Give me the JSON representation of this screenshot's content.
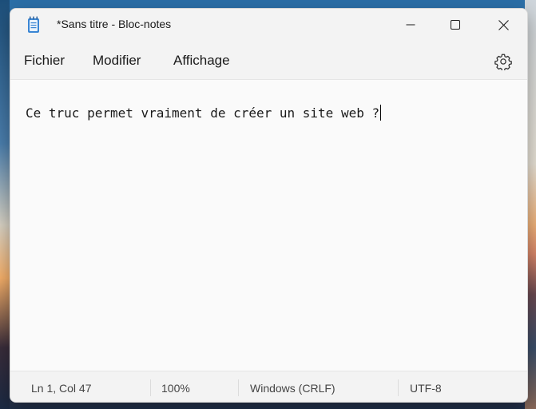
{
  "window": {
    "title": "*Sans titre - Bloc-notes",
    "app_icon": "notepad-icon"
  },
  "titlebar_buttons": {
    "minimize_icon": "minimize-icon",
    "maximize_icon": "maximize-icon",
    "close_icon": "close-icon"
  },
  "menu": {
    "items": [
      {
        "label": "Fichier"
      },
      {
        "label": "Modifier"
      },
      {
        "label": "Affichage"
      }
    ],
    "settings_icon": "gear-icon"
  },
  "editor": {
    "content": "Ce truc permet vraiment de créer un site web ?"
  },
  "status": {
    "position": "Ln 1, Col 47",
    "zoom": "100%",
    "line_endings": "Windows (CRLF)",
    "encoding": "UTF-8"
  }
}
